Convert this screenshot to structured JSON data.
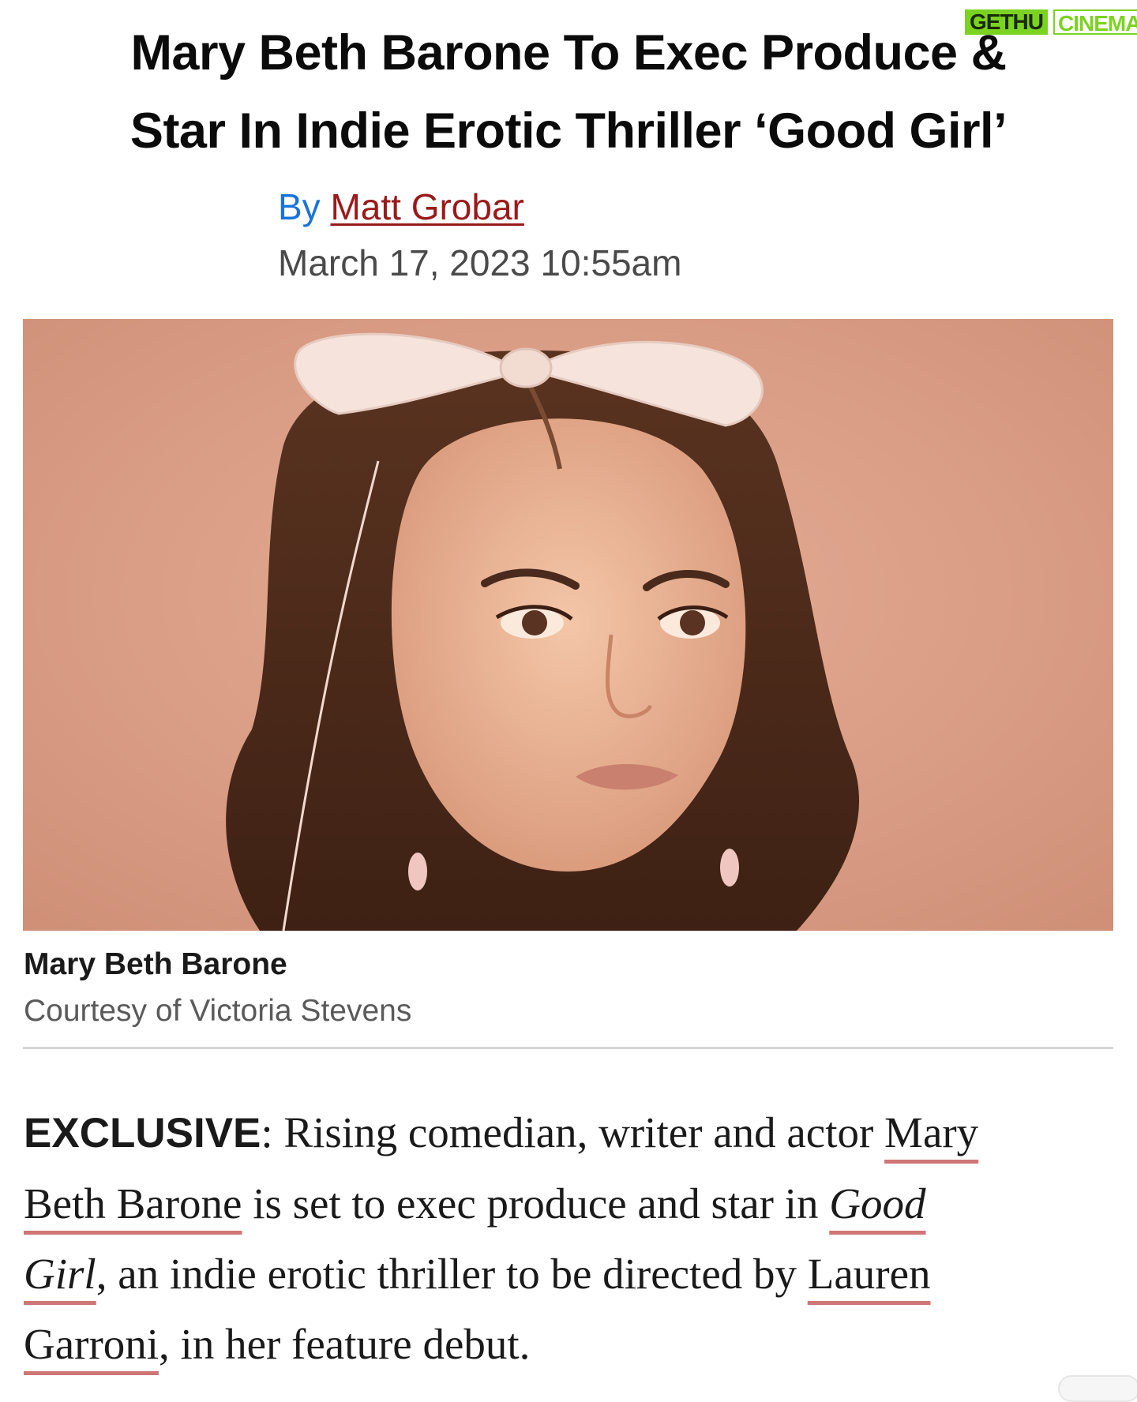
{
  "headline": {
    "line1": "Mary Beth Barone To Exec Produce &",
    "line2": "Star In Indie Erotic Thriller ‘Good Girl’"
  },
  "watermark": {
    "part1": "GETHU",
    "part2": "CINEMA"
  },
  "byline": {
    "prefix": "By",
    "author": "Matt Grobar"
  },
  "date": "March 17, 2023 10:55am",
  "caption": {
    "name": "Mary Beth Barone",
    "credit": "Courtesy of Victoria Stevens"
  },
  "article": {
    "lead_label": "EXCLUSIVE",
    "line1_text": ": Rising comedian, writer and actor ",
    "line1_link": "Mary",
    "line2_link": "Beth Barone",
    "line2_text": " is set to exec produce and star in ",
    "line2_link2": "Good",
    "line3_link": "Girl",
    "line3_text": ", an indie erotic thriller to be directed by ",
    "line3_link2": "Lauren",
    "line4_link": "Garroni",
    "line4_text": ", in her feature debut."
  },
  "colors": {
    "byline_prefix": "#1a73d9",
    "author_link": "#9a1a1a",
    "link_underline": "#cf7676",
    "photo_background": "#d89a82"
  }
}
